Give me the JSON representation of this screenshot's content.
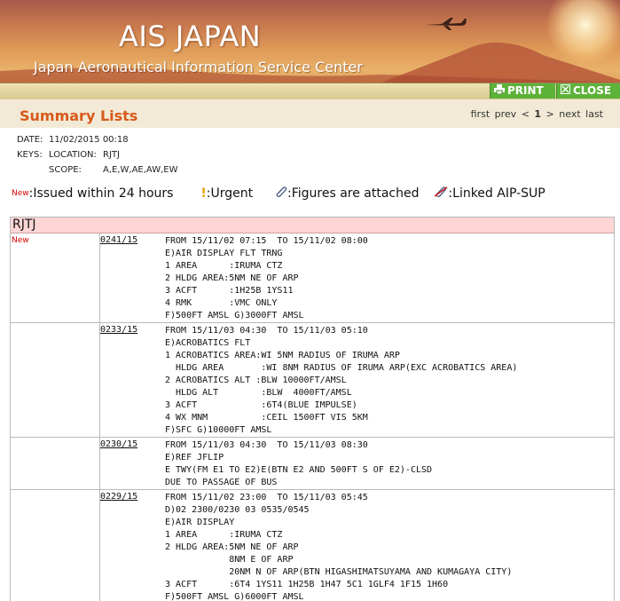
{
  "header": {
    "title": "AIS JAPAN",
    "subtitle": "Japan Aeronautical Information Service Center"
  },
  "toolbar": {
    "print_label": "PRINT",
    "close_label": "CLOSE"
  },
  "summary": {
    "title": "Summary Lists",
    "pager": {
      "first": "first",
      "prev": "prev",
      "lt": "<",
      "current": "1",
      "gt": ">",
      "next": "next",
      "last": "last"
    }
  },
  "meta": {
    "date_label": "DATE:",
    "date_value": "11/02/2015 00:18",
    "keys_label": "KEYS:",
    "location_label": "LOCATION:",
    "location_value": "RJTJ",
    "scope_label": "SCOPE:",
    "scope_value": "A,E,W,AE,AW,EW"
  },
  "legend": {
    "new_tag": "New",
    "new_text": ":Issued within 24 hours",
    "urgent_icon": "!",
    "urgent_text": ":Urgent",
    "figures_text": ":Figures are attached",
    "linked_text": ":Linked AIP-SUP",
    "icons": [
      "new-badge",
      "exclamation-icon",
      "paperclip-icon",
      "linked-clip-icon"
    ]
  },
  "location_header": "RJTJ",
  "notams": [
    {
      "new": "New",
      "number": "0241/15",
      "lines": [
        "FROM 15/11/02 07:15  TO 15/11/02 08:00",
        "E)AIR DISPLAY FLT TRNG",
        "1 AREA      :IRUMA CTZ",
        "2 HLDG AREA:5NM NE OF ARP",
        "3 ACFT      :1H25B 1YS11",
        "4 RMK       :VMC ONLY",
        "F)500FT AMSL G)3000FT AMSL"
      ]
    },
    {
      "new": "",
      "number": "0233/15",
      "lines": [
        "FROM 15/11/03 04:30  TO 15/11/03 05:10",
        "E)ACROBATICS FLT",
        "1 ACROBATICS AREA:WI 5NM RADIUS OF IRUMA ARP",
        "  HLDG AREA       :WI 8NM RADIUS OF IRUMA ARP(EXC ACROBATICS AREA)",
        "2 ACROBATICS ALT :BLW 10000FT/AMSL",
        "  HLDG ALT        :BLW  4000FT/AMSL",
        "3 ACFT            :6T4(BLUE IMPULSE)",
        "4 WX MNM          :CEIL 1500FT VIS 5KM",
        "F)SFC G)10000FT AMSL"
      ]
    },
    {
      "new": "",
      "number": "0230/15",
      "lines": [
        "FROM 15/11/03 04:30  TO 15/11/03 08:30",
        "E)REF JFLIP",
        "E TWY(FM E1 TO E2)E(BTN E2 AND 500FT S OF E2)-CLSD",
        "DUE TO PASSAGE OF BUS"
      ]
    },
    {
      "new": "",
      "number": "0229/15",
      "lines": [
        "FROM 15/11/02 23:00  TO 15/11/03 05:45",
        "D)02 2300/0230 03 0535/0545",
        "E)AIR DISPLAY",
        "1 AREA      :IRUMA CTZ",
        "2 HLDG AREA:5NM NE OF ARP",
        "            8NM E OF ARP",
        "            20NM N OF ARP(BTN HIGASHIMATSUYAMA AND KUMAGAYA CITY)",
        "3 ACFT      :6T4 1YS11 1H25B 1H47 5C1 1GLF4 1F15 1H60",
        "F)500FT AMSL G)6000FT AMSL"
      ]
    }
  ]
}
